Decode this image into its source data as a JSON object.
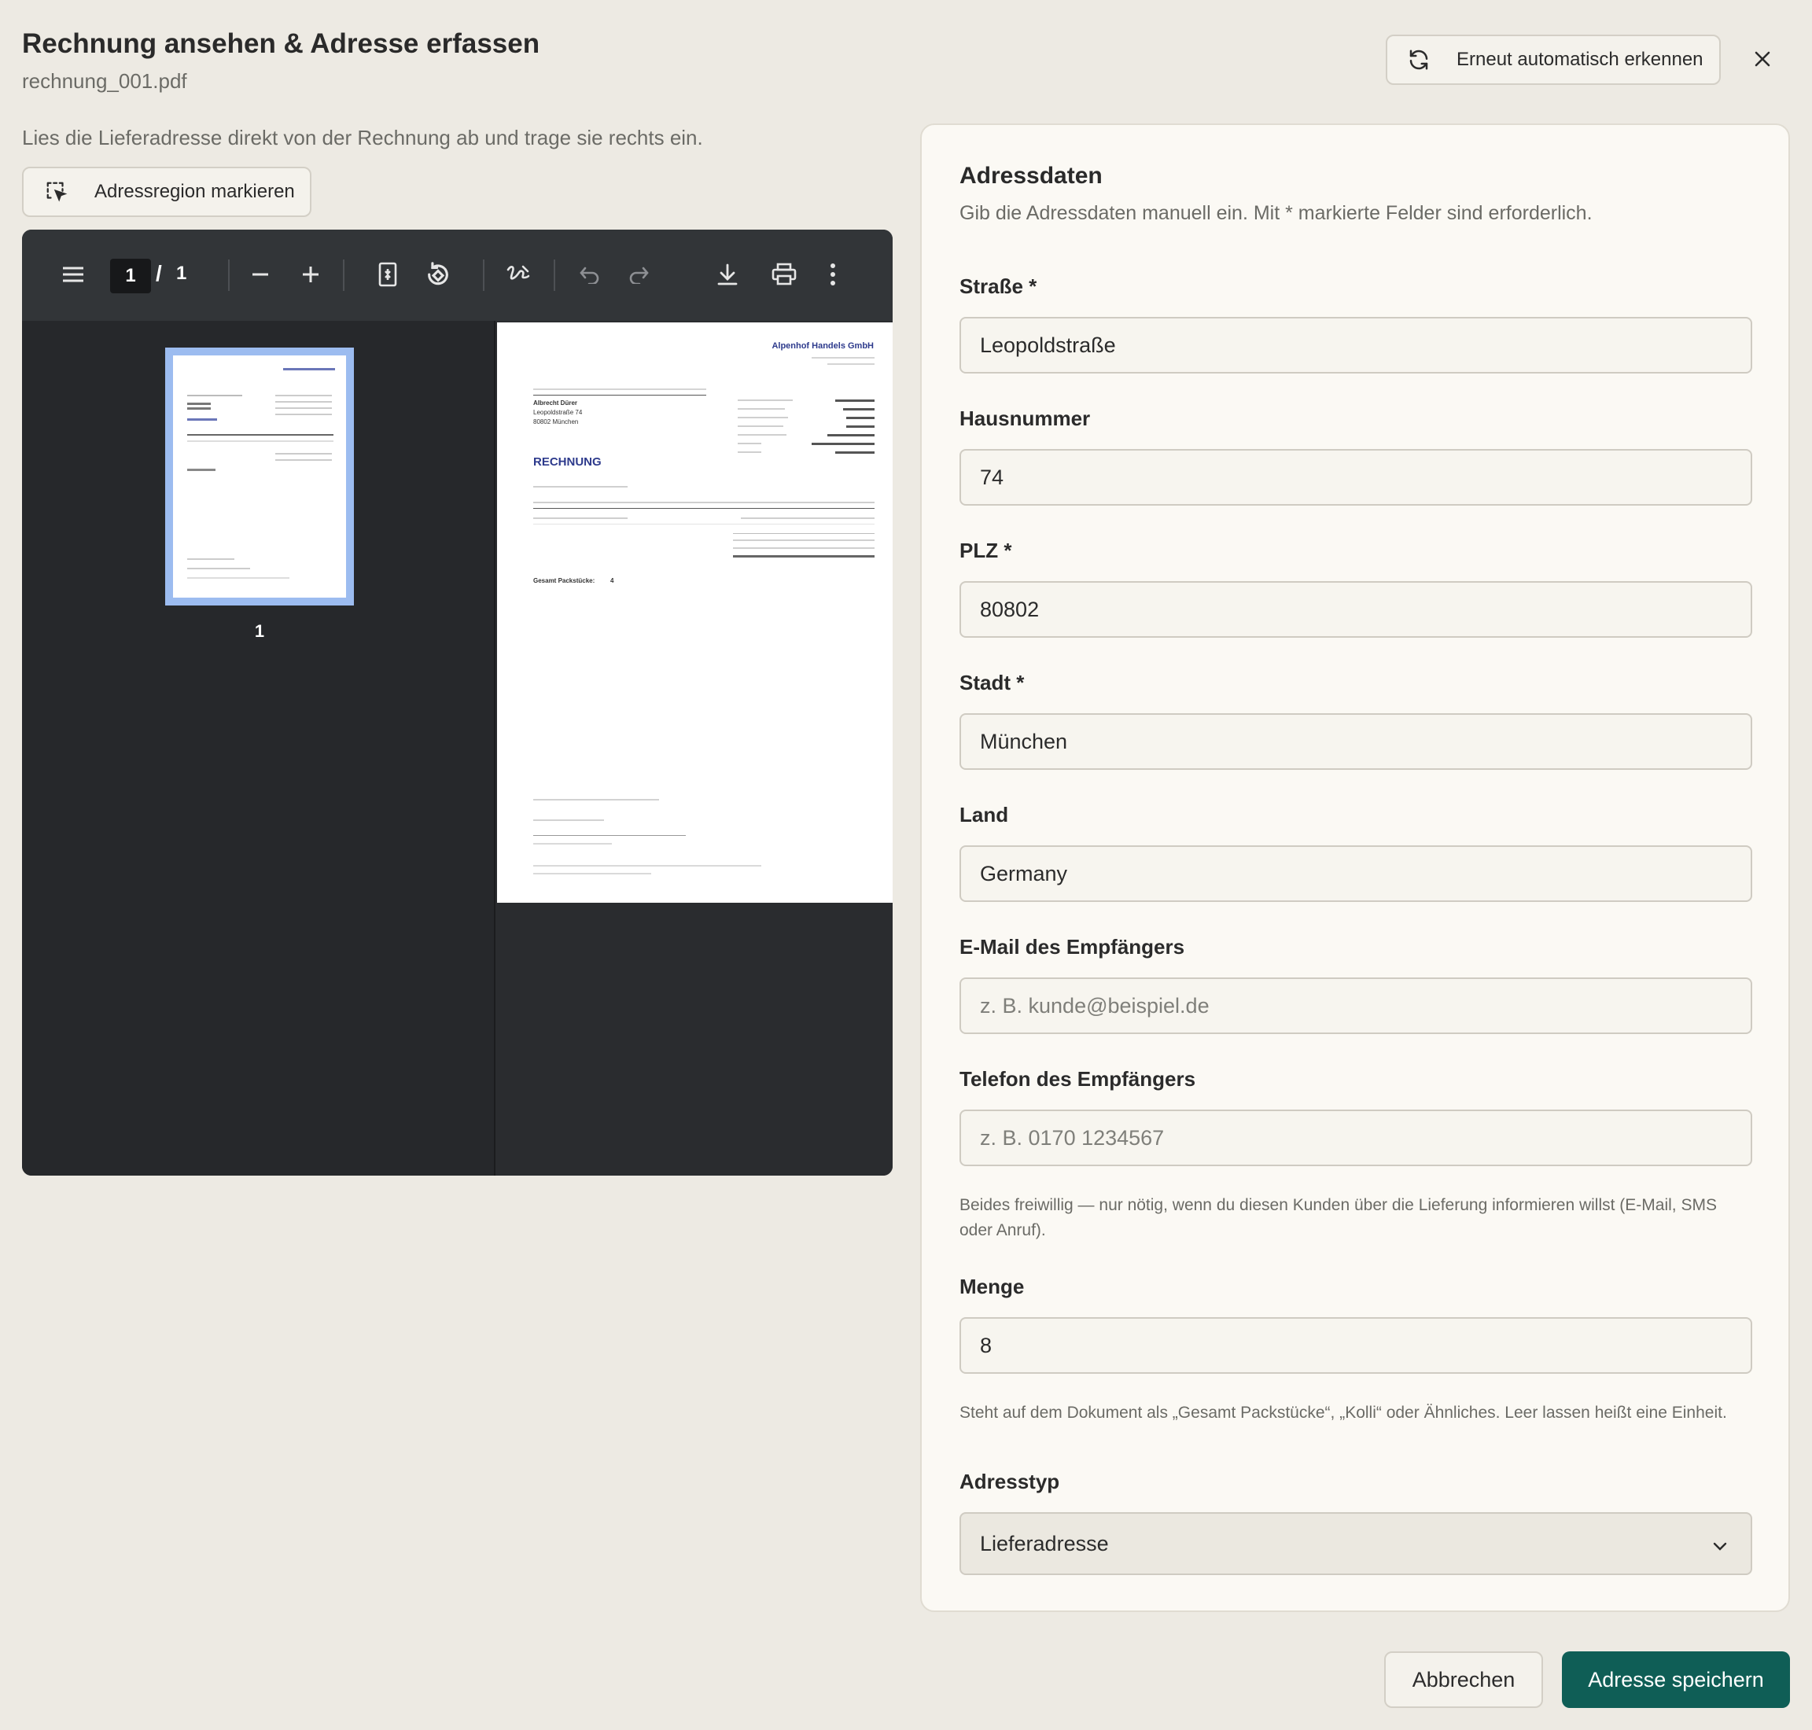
{
  "header": {
    "title": "Rechnung ansehen & Adresse erfassen",
    "filename": "rechnung_001.pdf",
    "redetect_label": "Erneut automatisch erkennen"
  },
  "left": {
    "instructions": "Lies die Lieferadresse direkt von der Rechnung ab und trage sie rechts ein.",
    "mark_region_label": "Adressregion markieren"
  },
  "viewer": {
    "current_page": "1",
    "page_separator": "/",
    "total_pages": "1",
    "thumbnail_label": "1",
    "document": {
      "company": "Alpenhof Handels GmbH",
      "heading": "RECHNUNG",
      "recipient_name": "Albrecht Dürer",
      "recipient_street": "Leopoldstraße 74",
      "recipient_city": "80802 München",
      "total_packages_label": "Gesamt Packstücke:",
      "total_packages_value": "4"
    }
  },
  "form": {
    "title": "Adressdaten",
    "description": "Gib die Adressdaten manuell ein. Mit * markierte Felder sind erforderlich.",
    "street": {
      "label": "Straße *",
      "value": "Leopoldstraße"
    },
    "house_number": {
      "label": "Hausnummer",
      "value": "74"
    },
    "zip": {
      "label": "PLZ *",
      "value": "80802"
    },
    "city": {
      "label": "Stadt *",
      "value": "München"
    },
    "country": {
      "label": "Land",
      "value": "Germany"
    },
    "email": {
      "label": "E-Mail des Empfängers",
      "value": "",
      "placeholder": "z. B. kunde@beispiel.de"
    },
    "phone": {
      "label": "Telefon des Empfängers",
      "value": "",
      "placeholder": "z. B. 0170 1234567"
    },
    "contact_hint": "Beides freiwillig — nur nötig, wenn du diesen Kunden über die Lieferung informieren willst (E-Mail, SMS oder Anruf).",
    "quantity": {
      "label": "Menge",
      "value": "8"
    },
    "quantity_hint": "Steht auf dem Dokument als „Gesamt Packstücke“, „Kolli“ oder Ähnliches. Leer lassen heißt eine Einheit.",
    "address_type": {
      "label": "Adresstyp",
      "selected": "Lieferadresse"
    }
  },
  "footer": {
    "cancel_label": "Abbrechen",
    "save_label": "Adresse speichern"
  },
  "colors": {
    "background": "#edeae3",
    "primary": "#0f5e56",
    "viewer_dark": "#2a2c2f"
  },
  "icons": [
    "refresh-icon",
    "close-icon",
    "region-select-icon",
    "menu-icon",
    "zoom-out-icon",
    "zoom-in-icon",
    "fit-page-icon",
    "rotate-icon",
    "draw-icon",
    "undo-icon",
    "redo-icon",
    "download-icon",
    "print-icon",
    "more-vertical-icon",
    "chevron-down-icon"
  ]
}
